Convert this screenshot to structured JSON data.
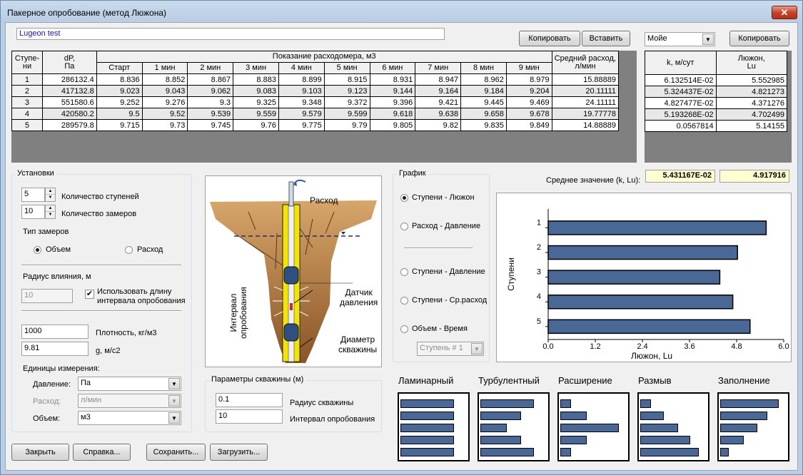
{
  "window": {
    "title": "Пакерное опробование (метод Люжона)",
    "close": "✕"
  },
  "test_name": "Lugeon test",
  "buttons": {
    "copy1": "Копировать",
    "paste": "Вставить",
    "copy2": "Копировать",
    "close": "Закрыть",
    "help": "Справка...",
    "save": "Сохранить...",
    "load": "Загрузить..."
  },
  "source_select": "Мойе",
  "table1": {
    "h_step": "Ступе-\nни",
    "h_dp": "dP,\nПа",
    "h_flow": "Показание расходомера, м3",
    "h_avg": "Средний расход,\nл/мин",
    "sub": [
      "Старт",
      "1 мин",
      "2 мин",
      "3 мин",
      "4 мин",
      "5 мин",
      "6 мин",
      "7 мин",
      "8 мин",
      "9 мин"
    ],
    "rows": [
      {
        "n": "1",
        "dp": "286132.4",
        "v": [
          "8.836",
          "8.852",
          "8.867",
          "8.883",
          "8.899",
          "8.915",
          "8.931",
          "8.947",
          "8.962",
          "8.979"
        ],
        "avg": "15.88889"
      },
      {
        "n": "2",
        "dp": "417132.8",
        "v": [
          "9.023",
          "9.043",
          "9.062",
          "9.083",
          "9.103",
          "9.123",
          "9.144",
          "9.164",
          "9.184",
          "9.204"
        ],
        "avg": "20.11111"
      },
      {
        "n": "3",
        "dp": "551580.6",
        "v": [
          "9.252",
          "9.276",
          "9.3",
          "9.325",
          "9.348",
          "9.372",
          "9.396",
          "9.421",
          "9.445",
          "9.469"
        ],
        "avg": "24.11111"
      },
      {
        "n": "4",
        "dp": "420580.2",
        "v": [
          "9.5",
          "9.52",
          "9.539",
          "9.559",
          "9.579",
          "9.599",
          "9.618",
          "9.638",
          "9.658",
          "9.678"
        ],
        "avg": "19.77778"
      },
      {
        "n": "5",
        "dp": "289579.8",
        "v": [
          "9.715",
          "9.73",
          "9.745",
          "9.76",
          "9.775",
          "9.79",
          "9.805",
          "9.82",
          "9.835",
          "9.849"
        ],
        "avg": "14.88889"
      }
    ]
  },
  "table2": {
    "h_k": "k, м/сут",
    "h_lu": "Люжон,\nLu",
    "rows": [
      {
        "k": "6.132514E-02",
        "lu": "5.552985"
      },
      {
        "k": "5.324437E-02",
        "lu": "4.821273"
      },
      {
        "k": "4.827477E-02",
        "lu": "4.371276"
      },
      {
        "k": "5.193268E-02",
        "lu": "4.702499"
      },
      {
        "k": "0.0567814",
        "lu": "5.14155"
      }
    ]
  },
  "settings": {
    "title": "Установки",
    "steps": "5",
    "steps_label": "Количество ступеней",
    "samples": "10",
    "samples_label": "Количество замеров",
    "type_label": "Тип замеров",
    "type_volume": "Объем",
    "type_flow": "Расход",
    "radius_label": "Радиус влияния, м",
    "radius_value": "10",
    "use_len": "Использовать длину\nинтервала опробования",
    "density": "1000",
    "density_label": "Плотность, кг/м3",
    "g": "9.81",
    "g_label": "g, м/с2",
    "units_title": "Единицы измерения:",
    "pressure_label": "Давление:",
    "pressure": "Па",
    "flow_label": "Расход:",
    "flow": "л/мин",
    "volume_label": "Объем:",
    "volume": "м3"
  },
  "diagram": {
    "flow": "Расход",
    "interval": "Интервал\nопробования",
    "sensor": "Датчик\nдавления",
    "diameter": "Диаметр\nскважины"
  },
  "well": {
    "title": "Параметры скважины (м)",
    "radius": "0.1",
    "radius_label": "Радиус скважины",
    "interval": "10",
    "interval_label": "Интервал опробования"
  },
  "graph": {
    "title": "График",
    "opt1": "Ступени - Люжон",
    "opt2": "Расход - Давление",
    "opt3": "Ступени - Давление",
    "opt4": "Ступени - Ср.расход",
    "opt5": "Объем - Время",
    "step_select": "Ступень # 1"
  },
  "mean": {
    "label": "Среднее значение (k, Lu):",
    "k": "5.431167E-02",
    "lu": "4.917916"
  },
  "chart_data": {
    "type": "bar",
    "orientation": "horizontal",
    "categories": [
      "1",
      "2",
      "3",
      "4",
      "5"
    ],
    "values": [
      5.552985,
      4.821273,
      4.371276,
      4.702499,
      5.14155
    ],
    "xlabel": "Люжон, Lu",
    "ylabel": "Ступени",
    "xlim": [
      0,
      6.0
    ],
    "xticks": [
      "0.0",
      "1.2",
      "2.4",
      "3.6",
      "4.8",
      "6.0"
    ],
    "bar_color": "#4a6896"
  },
  "patterns": [
    {
      "name": "Ламинарный",
      "values": [
        0.92,
        0.92,
        0.92,
        0.92,
        0.92
      ]
    },
    {
      "name": "Турбулентный",
      "values": [
        0.92,
        0.7,
        0.45,
        0.7,
        0.92
      ]
    },
    {
      "name": "Расширение",
      "values": [
        0.18,
        0.45,
        1.0,
        0.45,
        0.18
      ]
    },
    {
      "name": "Размыв",
      "values": [
        0.18,
        0.4,
        0.65,
        0.85,
        1.0
      ]
    },
    {
      "name": "Заполнение",
      "values": [
        1.0,
        0.8,
        0.63,
        0.4,
        0.15
      ]
    }
  ]
}
